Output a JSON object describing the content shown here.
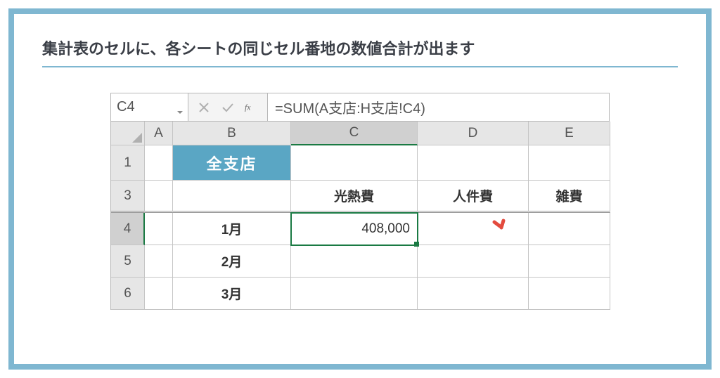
{
  "title": "集計表のセルに、各シートの同じセル番地の数値合計が出ます",
  "namebox": {
    "value": "C4"
  },
  "formula": {
    "value": "=SUM(A支店:H支店!C4)"
  },
  "columns": [
    "A",
    "B",
    "C",
    "D",
    "E"
  ],
  "rows": [
    "1",
    "3",
    "4",
    "5",
    "6"
  ],
  "badge": "全支店",
  "headers_row3": {
    "C": "光熱費",
    "D": "人件費",
    "E": "雑費"
  },
  "col_b": {
    "r4": "1月",
    "r5": "2月",
    "r6": "3月"
  },
  "values": {
    "C4": "408,000"
  },
  "active": {
    "row": "4",
    "col": "C"
  },
  "chart_data": {
    "type": "table",
    "title": "全支店",
    "columns": [
      "",
      "光熱費",
      "人件費",
      "雑費"
    ],
    "rows": [
      {
        "label": "1月",
        "values": [
          408000,
          null,
          null
        ]
      },
      {
        "label": "2月",
        "values": [
          null,
          null,
          null
        ]
      },
      {
        "label": "3月",
        "values": [
          null,
          null,
          null
        ]
      }
    ]
  }
}
